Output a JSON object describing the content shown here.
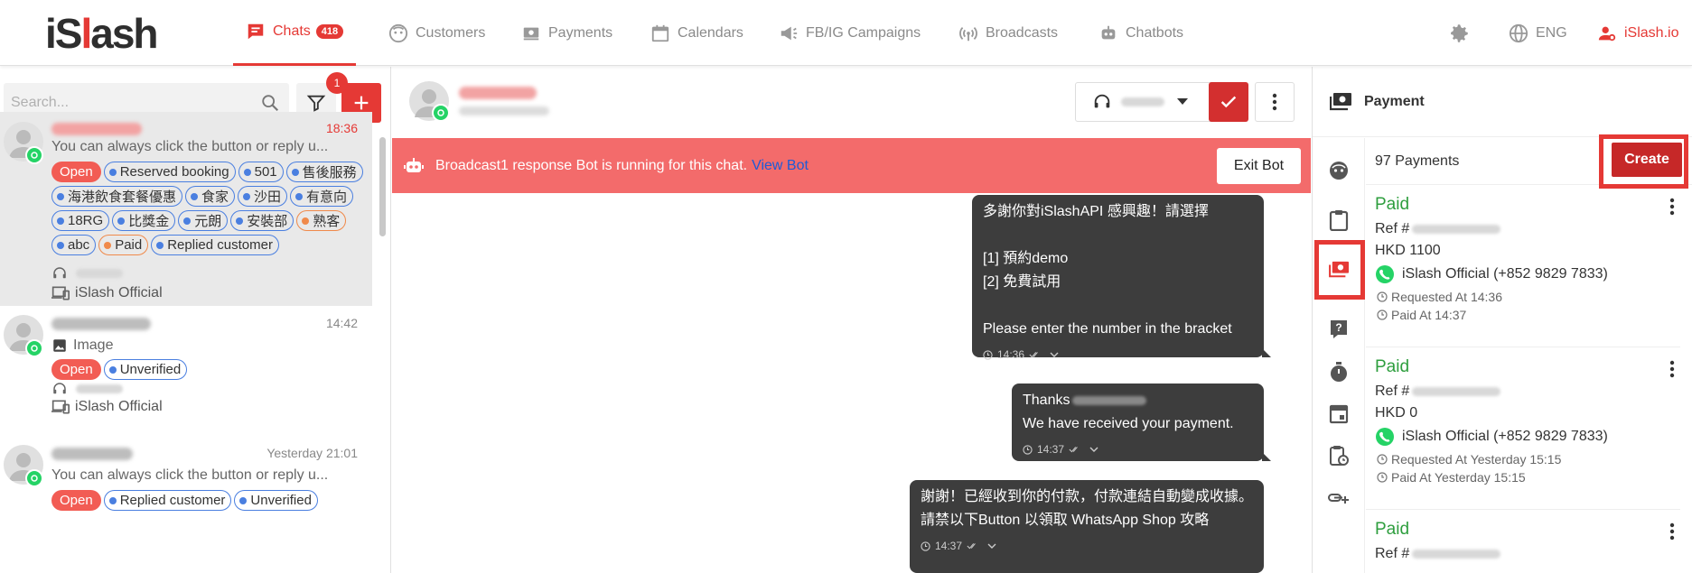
{
  "brand": {
    "logo_left": "iS",
    "logo_slash": "l",
    "logo_right": "ash"
  },
  "nav": {
    "chats": "Chats",
    "chats_count": "418",
    "customers": "Customers",
    "payments": "Payments",
    "calendars": "Calendars",
    "campaigns": "FB/IG Campaigns",
    "broadcasts": "Broadcasts",
    "chatbots": "Chatbots",
    "language": "ENG",
    "account": "iSlash.io"
  },
  "colors": {
    "accent": "#e53935",
    "tag_blue": "#4a7fe0",
    "tag_orange": "#f08a4b",
    "paid_green": "#2e9e3e",
    "bubble": "#3d3d3d",
    "bot_bar": "#f36b6b"
  },
  "search": {
    "placeholder": "Search..."
  },
  "filter": {
    "badge": "1"
  },
  "chat_list": {
    "items": [
      {
        "time": "18:36",
        "message": "You can always click the button or reply u...",
        "status": "Open",
        "tags": [
          "Reserved booking",
          "501",
          "售後服務",
          "海港飲食套餐優惠",
          "食家",
          "沙田",
          "有意向",
          "18RG",
          "比獎金",
          "元朗",
          "安裝部",
          "熟客",
          "abc",
          "Paid",
          "Replied customer"
        ],
        "channel": "iSlash Official"
      },
      {
        "time": "14:42",
        "message": "Image",
        "status": "Open",
        "tags": [
          "Unverified"
        ],
        "channel": "iSlash Official"
      },
      {
        "time": "Yesterday 21:01",
        "message": "You can always click the button or reply u...",
        "status": "Open",
        "tags": [
          "Replied customer",
          "Unverified"
        ]
      }
    ]
  },
  "bot_bar": {
    "text": "Broadcast1 response Bot is running for this chat.",
    "link": "View Bot",
    "exit": "Exit Bot"
  },
  "messages": [
    {
      "lines": [
        "多謝你對iSlashAPI 感興趣！請選擇",
        "",
        "[1] 預約demo",
        "[2] 免費試用",
        "",
        "Please enter the number in the bracket"
      ],
      "time": "14:36"
    },
    {
      "lines": [
        "Thanks",
        "We have received your payment."
      ],
      "time": "14:37"
    },
    {
      "lines": [
        "謝謝！已經收到你的付款，付款連結自動變成收據。",
        "請禁以下Button 以領取 WhatsApp Shop 攻略"
      ],
      "time": "14:37"
    }
  ],
  "payment_panel": {
    "title": "Payment",
    "count": "97 Payments",
    "create": "Create",
    "cards": [
      {
        "status": "Paid",
        "ref": "Ref #",
        "amount": "HKD 1100",
        "account": "iSlash Official (+852 9829 7833)",
        "requested": "Requested At 14:36",
        "paid": "Paid At 14:37"
      },
      {
        "status": "Paid",
        "ref": "Ref #",
        "amount": "HKD 0",
        "account": "iSlash Official (+852 9829 7833)",
        "requested": "Requested At Yesterday 15:15",
        "paid": "Paid At Yesterday 15:15"
      },
      {
        "status": "Paid",
        "ref": "Ref #"
      }
    ]
  }
}
